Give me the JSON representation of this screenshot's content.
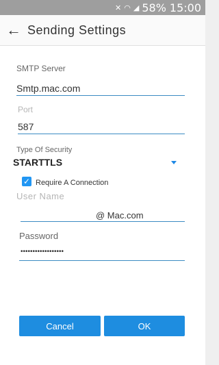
{
  "status_bar": {
    "battery": "58%",
    "time": "15:00",
    "icons": [
      "mute-icon",
      "wifi-icon",
      "signal-icon"
    ]
  },
  "app_bar": {
    "back_icon": "arrow-left-icon",
    "title": "Sending Settings"
  },
  "form": {
    "smtp_server": {
      "label": "SMTP Server",
      "value": "Smtp.mac.com"
    },
    "port": {
      "label": "Port",
      "value": "587"
    },
    "security": {
      "label": "Type Of Security",
      "value": "STARTTLS"
    },
    "require_connection": {
      "label": "Require A Connection",
      "checked": true
    },
    "user_name": {
      "label": "User Name",
      "suffix": "@ Mac.com"
    },
    "password": {
      "label": "Password",
      "value": "••••••••••••••••••"
    }
  },
  "buttons": {
    "cancel": "Cancel",
    "ok": "OK"
  },
  "colors": {
    "accent": "#1e8de0",
    "underline": "#3b8bc2",
    "status_bar": "#9e9e9e"
  }
}
